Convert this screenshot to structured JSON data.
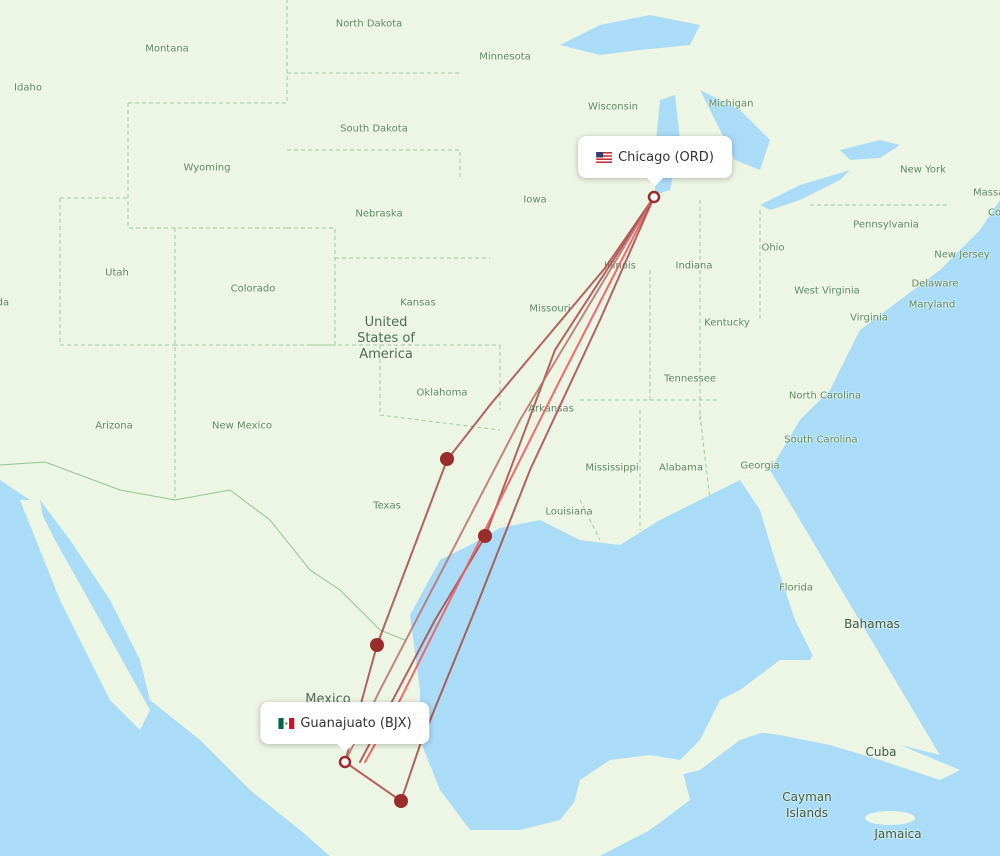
{
  "map": {
    "origin": {
      "name": "Chicago (ORD)",
      "country_flag": "us-flag"
    },
    "destination": {
      "name": "Guanajuato (BJX)",
      "country_flag": "mx-flag"
    },
    "route_color": "#9b2c2c",
    "highlight_color": "#ef5b5b",
    "water_color": "#aadcf7",
    "land_color": "#edf5e4",
    "labels": {
      "states": [
        "Idaho",
        "Montana",
        "North Dakota",
        "Minnesota",
        "Wisconsin",
        "Michigan",
        "South Dakota",
        "Wyoming",
        "Nebraska",
        "Iowa",
        "Illinois",
        "Indiana",
        "Ohio",
        "Pennsylvania",
        "New York",
        "Utah",
        "Colorado",
        "Kansas",
        "Missouri",
        "Kentucky",
        "West Virginia",
        "Virginia",
        "Maryland",
        "Delaware",
        "New Jersey",
        "Massachusetts",
        "Connecticut",
        "Nevada",
        "Oklahoma",
        "Arkansas",
        "Tennessee",
        "North Carolina",
        "South Carolina",
        "Arizona",
        "New Mexico",
        "Texas",
        "Mississippi",
        "Alabama",
        "Georgia",
        "Louisiana",
        "Florida"
      ],
      "countries": [
        "United States of America",
        "Mexico",
        "Cuba",
        "Bahamas",
        "Jamaica"
      ],
      "other": [
        "Cayman Islands"
      ]
    },
    "stopover_count": 4
  }
}
